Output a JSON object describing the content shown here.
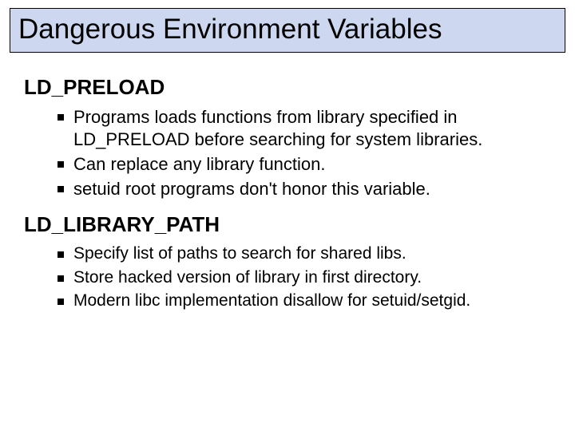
{
  "title": "Dangerous Environment Variables",
  "sections": [
    {
      "heading": "LD_PRELOAD",
      "items": [
        "Programs loads functions from library specified in LD_PRELOAD before searching for system libraries.",
        "Can replace any library function.",
        "setuid root programs don't honor this variable."
      ]
    },
    {
      "heading": "LD_LIBRARY_PATH",
      "items": [
        "Specify list of paths to search for shared libs.",
        "Store hacked version of library in first directory.",
        "Modern libc implementation disallow for setuid/setgid."
      ]
    }
  ]
}
